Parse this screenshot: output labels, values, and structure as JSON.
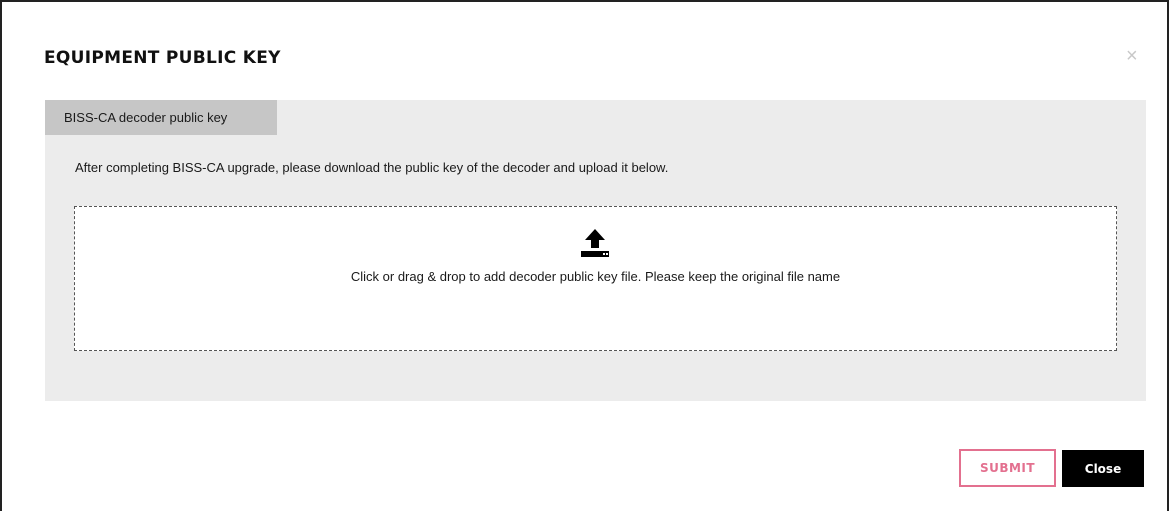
{
  "modal": {
    "title": "EQUIPMENT PUBLIC KEY",
    "close_glyph": "×"
  },
  "tab": {
    "label": "BISS-CA decoder public key"
  },
  "panel": {
    "instructions": "After completing BISS-CA upgrade, please download the public key of the decoder and upload it below."
  },
  "dropzone": {
    "icon": "upload-icon",
    "text": "Click or drag & drop to add decoder public key file. Please keep the original file name"
  },
  "footer": {
    "submit_label": "SUBMIT",
    "close_label": "Close"
  },
  "colors": {
    "accent": "#e3708f",
    "panel_bg": "#ececec",
    "tab_bg": "#c6c6c6"
  }
}
